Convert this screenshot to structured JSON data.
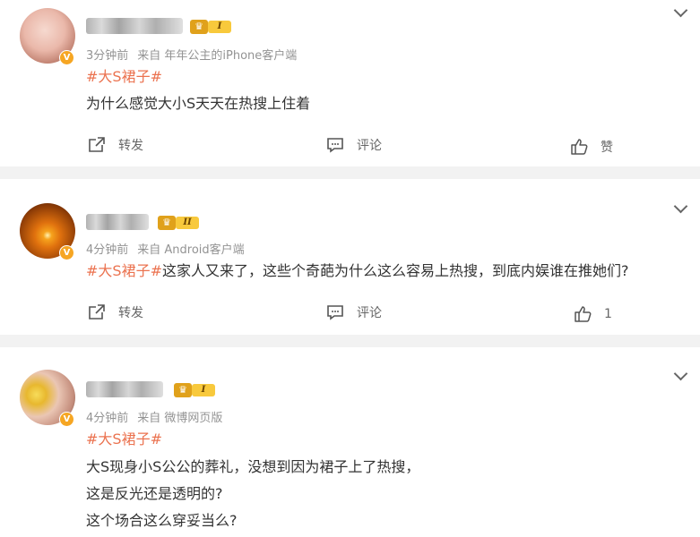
{
  "comments": [
    {
      "time": "3分钟前",
      "source": "来自 年年公主的iPhone客户端",
      "level_badge": "I",
      "hashtag": "#大S裙子#",
      "text": "为什么感觉大小S天天在热搜上住着",
      "actions": {
        "repost": "转发",
        "comment": "评论",
        "like": "赞"
      }
    },
    {
      "time": "4分钟前",
      "source": "来自 Android客户端",
      "level_badge": "II",
      "hashtag": "#大S裙子#",
      "text": "这家人又来了，这些个奇葩为什么这么容易上热搜，到底内娱谁在推她们?",
      "actions": {
        "repost": "转发",
        "comment": "评论",
        "like": "1"
      }
    },
    {
      "time": "4分钟前",
      "source": "来自 微博网页版",
      "level_badge": "I",
      "hashtag": "#大S裙子#",
      "lines": [
        "大S现身小S公公的葬礼，没想到因为裙子上了热搜，",
        "这是反光还是透明的?",
        "这个场合这么穿妥当么?"
      ]
    }
  ],
  "verified_mark": "V",
  "crown_glyph": "♛",
  "accent_color": "#eb7350"
}
